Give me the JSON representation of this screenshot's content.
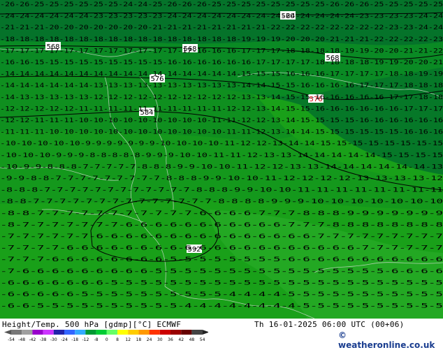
{
  "footer": {
    "title": "Height/Temp. 500 hPa [gdmp][°C] ECMWF",
    "valid_time": "Th 16-01-2025 06:00 UTC (00+06)",
    "credit": "© weatheronline.co.uk"
  },
  "legend": {
    "tick_labels": [
      "-54",
      "-48",
      "-42",
      "-38",
      "-30",
      "-24",
      "-18",
      "-12",
      "-8",
      "0",
      "8",
      "12",
      "18",
      "24",
      "30",
      "36",
      "42",
      "48",
      "54"
    ],
    "colors": [
      "#787878",
      "#a0a0a0",
      "#9900cc",
      "#cc33ff",
      "#2222aa",
      "#3366ff",
      "#33aaff",
      "#009933",
      "#00cc33",
      "#66ff66",
      "#ffff00",
      "#ffcc00",
      "#ff9900",
      "#ff3300",
      "#cc0000",
      "#990000",
      "#660000",
      "#444444"
    ]
  },
  "map": {
    "geopotential_labels": [
      "560",
      "568",
      "568",
      "568",
      "576",
      "576",
      "584",
      "592"
    ],
    "temperature_rows": [
      "-26-26-25-25-25-25-25-25-24-24-25-26-26-26-25-25-25-25-25-25-25-25-26-26-26-25-25-25-25-25",
      "-24-24-24-24-24-24-23-23-23-23-23-24-24-24-24-24-24-24-24-24-24-24-24-24-23-23-23-23-24-24",
      "-21-21-21-20-20-20-20-20-20-20-21-21-21-21-21-21-21-21-22-22-22-22-22-22-22-22-23-23-24-24",
      "-18-18-18-18-18-18-18-18-18-18-18-18-18-18-18-18-19-19-19-20-20-20-21-21-21-22-22-22-22-23",
      "-17-17-17-17-17-17-17-17-17-17-17-17-17-16-16-16-17-17-17-18-18-18-18-19-19-20-20-21-21-22",
      "-16-16-15-15-15-15-15-15-15-15-15-16-16-16-16-16-16-17-17-17-17-18-18-18-18-19-19-20-20-21",
      "-14-14-14-14-14-14-14-14-14-14-14-14-14-14-14-14-15-15-15-16-16-16-17-17-17-17-18-18-19-19",
      "-14-14-14-14-14-14-13-13-13-13-13-13-13-13-13-13-14-14-15-15-16-16-16-16-17-17-17-18-18-18",
      "-14-13-13-13-13-13-12-12-12-12-12-12-12-12-12-12-13-13-14-15-15-16-16-16-16-16-17-17-18-18",
      "-12-12-12-12-12-11-11-11-11-11-11-11-11-11-11-12-12-13-14-15-15-16-16-16-16-16-16-17-17-17",
      "-12-12-11-11-11-10-10-10-10-10-10-10-10-10-11-11-12-12-13-14-15-15-15-15-16-16-16-16-16-16",
      "-11-11-11-10-10-10-10-10-10-10-10-10-10-10-10-11-11-12-13-14-14-15-15-15-15-15-15-16-16-16",
      "-10-10-10-10-10-9-9-9-9-9-9-9-10-10-10-10-11-12-12-13-14-14-15-15-15-15-15-15-15-15",
      "-10-10-10-9-9-9-8-8-8-8-8-9-9-9-10-10-11-11-12-13-13-14-14-14-14-14-15-15-15-15",
      "-10-9-9-8-8-8-7-7-7-7-7-8-8-8-9-9-10-10-11-12-12-13-13-14-14-14-14-14-14-13",
      "-9-9-8-8-7-7-7-7-7-7-7-7-7-8-8-8-9-9-10-10-11-12-12-12-12-13-13-13-13-12",
      "-8-8-8-7-7-7-7-7-7-7-7-7-7-7-7-8-8-8-9-9-10-10-11-11-11-11-11-11-11-11",
      "-8-8-7-7-7-7-7-7-7-7-7-7-7-7-7-7-8-8-8-8-9-9-9-10-10-10-10-10-10-10",
      "-8-8-7-7-7-7-7-7-7-7-7-7-7-6-6-6-6-7-7-7-8-8-8-9-9-9-9-9-9-9",
      "-8-7-7-7-7-7-7-7-6-6-6-6-6-6-6-6-6-6-6-7-7-7-8-8-8-8-8-8-8-8",
      "-7-7-7-7-7-7-6-6-6-6-6-6-6-6-6-6-6-6-6-6-6-7-7-7-7-7-7-7-7-7",
      "-7-7-7-7-6-6-6-6-6-6-6-6-6-6-6-6-6-6-6-6-6-6-6-6-7-7-7-7-7-7",
      "-7-7-7-6-6-6-6-6-6-6-6-5-5-5-5-5-5-5-5-6-6-6-6-6-6-6-6-6-6-6",
      "-7-6-6-6-6-6-6-6-6-6-5-5-5-5-5-5-5-5-5-5-5-5-5-5-5-5-6-6-6-6",
      "-6-6-6-6-6-6-6-5-5-5-5-5-5-5-5-5-5-5-5-5-5-5-5-5-5-5-5-5-5-5",
      "-6-6-6-6-6-5-5-5-5-5-5-5-5-5-5-4-4-4-4-5-5-5-5-5-5-5-5-5-5-5",
      "-6-6-5-5-5-5-5-5-5-5-5-5-4-4-4-4-4-4-4-4-5-5-5-5-5-5-5-5-5-5"
    ]
  }
}
